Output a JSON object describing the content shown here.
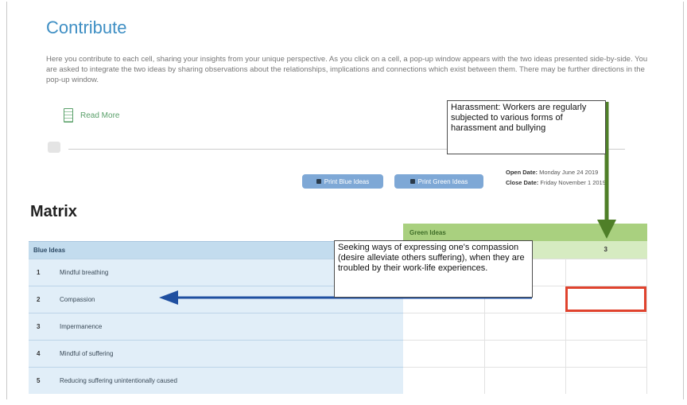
{
  "page": {
    "title": "Contribute",
    "intro": "Here you contribute to each cell, sharing your insights from your unique perspective. As you click on a cell, a pop-up window appears with the two ideas presented side-by-side. You are asked to integrate the two ideas by sharing observations about the relationships, implications and connections which exist between them. There may be further directions in the pop-up window.",
    "read_more": "Read More"
  },
  "buttons": {
    "print_blue": "Print Blue Ideas",
    "print_green": "Print Green Ideas"
  },
  "dates": {
    "open_label": "Open Date:",
    "open_value": "Monday June 24 2019",
    "close_label": "Close Date:",
    "close_value": "Friday November 1 2019"
  },
  "matrix": {
    "title": "Matrix",
    "green_header": "Green Ideas",
    "green_column_number": "3",
    "blue_header": "Blue Ideas",
    "rows": [
      {
        "num": "1",
        "label": "Mindful breathing"
      },
      {
        "num": "2",
        "label": "Compassion"
      },
      {
        "num": "3",
        "label": "Impermanence"
      },
      {
        "num": "4",
        "label": "Mindful of suffering"
      },
      {
        "num": "5",
        "label": "Reducing suffering unintentionally caused"
      }
    ]
  },
  "annotations": {
    "green_callout": "Harassment: Workers are regularly subjected to various forms of harassment and bullying",
    "blue_callout": "Seeking ways of expressing one's compassion (desire alleviate others suffering), when they are troubled by their work-life experiences."
  },
  "colors": {
    "title": "#3f8fc4",
    "green_arrow": "#4f7f28",
    "blue_arrow": "#1f4fa0",
    "highlight": "#e0432e"
  }
}
